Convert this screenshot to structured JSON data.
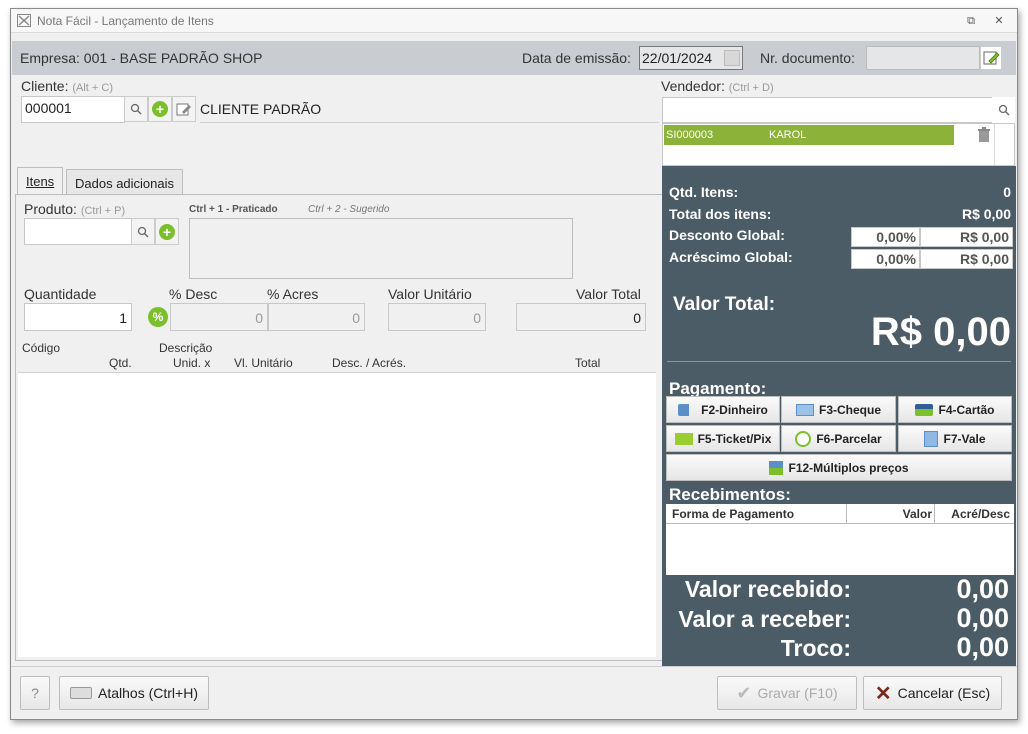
{
  "window": {
    "title": "Nota Fácil - Lançamento de Itens",
    "restore_glyph": "⧉",
    "close_glyph": "✕"
  },
  "header": {
    "empresa": "Empresa: 001 - BASE PADRÃO SHOP",
    "data_label": "Data de emissão:",
    "data_value": "22/01/2024",
    "doc_label": "Nr. documento:",
    "doc_value": ""
  },
  "cliente": {
    "label": "Cliente:",
    "shortcut": "(Alt + C)",
    "codigo": "000001",
    "nome": "CLIENTE PADRÃO"
  },
  "vendedor": {
    "label": "Vendedor:",
    "shortcut": "(Ctrl + D)",
    "search_value": "",
    "rows": [
      {
        "codigo": "SI000003",
        "nome": "KAROL"
      }
    ]
  },
  "tabs": [
    {
      "label": "Itens",
      "active": true
    },
    {
      "label": "Dados adicionais",
      "active": false
    }
  ],
  "produto": {
    "label": "Produto:",
    "shortcut": "(Ctrl + P)",
    "value": "",
    "hint_praticado": "Ctrl + 1 - Praticado",
    "hint_sugerido": "Ctrl + 2 - Sugerido"
  },
  "fields": {
    "quantidade_label": "Quantidade",
    "quantidade": "1",
    "desc_label": "% Desc",
    "desc": "0",
    "acres_label": "% Acres",
    "acres": "0",
    "unit_label": "Valor Unitário",
    "unit": "0",
    "total_label": "Valor Total",
    "total": "0"
  },
  "grid": {
    "col_codigo": "Código",
    "col_descricao": "Descrição",
    "col_qtd": "Qtd.",
    "col_unid": "Unid. x",
    "col_vl_unit": "Vl. Unitário",
    "col_desc_acres": "Desc. / Acrés.",
    "col_total": "Total",
    "rows": []
  },
  "summary": {
    "qtd_itens_label": "Qtd. Itens:",
    "qtd_itens": "0",
    "total_itens_label": "Total dos itens:",
    "total_itens": "R$ 0,00",
    "desconto_label": "Desconto Global:",
    "desconto_pct": "0,00%",
    "desconto_val": "R$ 0,00",
    "acrescimo_label": "Acréscimo Global:",
    "acrescimo_pct": "0,00%",
    "acrescimo_val": "R$ 0,00",
    "valor_total_label": "Valor Total:",
    "valor_total": "R$ 0,00"
  },
  "pagamento": {
    "label": "Pagamento:",
    "buttons": {
      "dinheiro": "F2-Dinheiro",
      "cheque": "F3-Cheque",
      "cartao": "F4-Cartão",
      "ticket": "F5-Ticket/Pix",
      "parcelar": "F6-Parcelar",
      "vale": "F7-Vale",
      "multiplos": "F12-Múltiplos preços"
    }
  },
  "recebimentos": {
    "label": "Recebimentos:",
    "col_forma": "Forma de Pagamento",
    "col_valor": "Valor",
    "col_acre": "Acré/Desc",
    "rows": []
  },
  "totais": {
    "recebido_label": "Valor recebido:",
    "recebido": "0,00",
    "a_receber_label": "Valor a receber:",
    "a_receber": "0,00",
    "troco_label": "Troco:",
    "troco": "0,00"
  },
  "footer": {
    "help": "?",
    "atalhos": "Atalhos (Ctrl+H)",
    "gravar": "Gravar (F10)",
    "cancelar": "Cancelar (Esc)"
  },
  "colors": {
    "accent_green": "#8db23a",
    "panel": "#4c5c66"
  }
}
